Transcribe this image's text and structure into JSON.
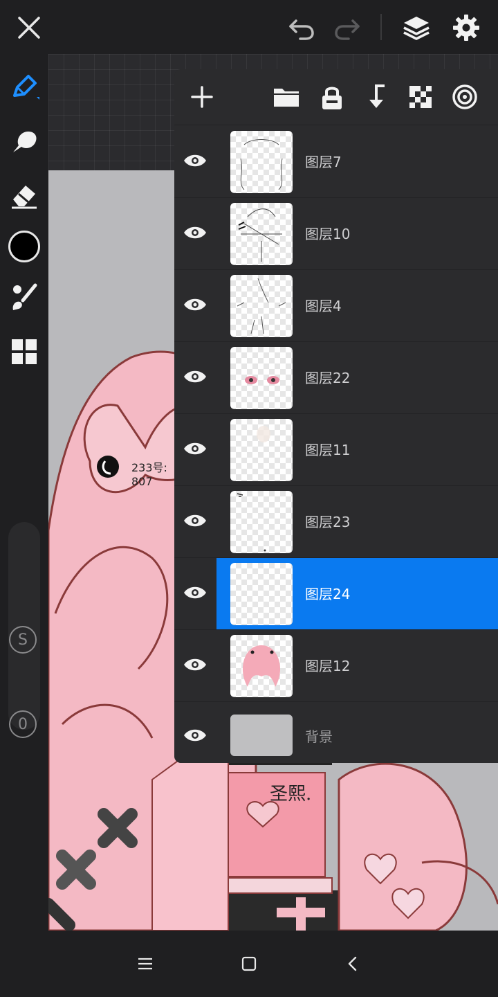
{
  "topbar": {
    "icons": [
      "close-icon",
      "undo-icon",
      "redo-icon",
      "layers-icon",
      "settings-icon"
    ]
  },
  "toolbar": {
    "tools": [
      "pen-icon",
      "smudge-icon",
      "eraser-icon",
      "color-swatch",
      "brush-icon",
      "gallery-icon"
    ],
    "current_color": "#000000",
    "size_badge": "S",
    "opacity_badge": "0"
  },
  "canvas": {
    "annotation_line1": "233号:",
    "annotation_line2": "807",
    "signature": "圣熙."
  },
  "layers_panel": {
    "actions": [
      "add-layer-icon",
      "folder-icon",
      "lock-icon",
      "merge-down-icon",
      "transparency-icon",
      "clipping-icon"
    ],
    "layers": [
      {
        "name": "图层7",
        "visible": true,
        "selected": false
      },
      {
        "name": "图层10",
        "visible": true,
        "selected": false
      },
      {
        "name": "图层4",
        "visible": true,
        "selected": false
      },
      {
        "name": "图层22",
        "visible": true,
        "selected": false
      },
      {
        "name": "图层11",
        "visible": true,
        "selected": false
      },
      {
        "name": "图层23",
        "visible": true,
        "selected": false
      },
      {
        "name": "图层24",
        "visible": true,
        "selected": true
      },
      {
        "name": "图层12",
        "visible": true,
        "selected": false
      },
      {
        "name": "背景",
        "visible": true,
        "selected": false
      }
    ]
  },
  "colors": {
    "selected_layer": "#0a7af0",
    "panel": "#2b2b2d",
    "chrome": "#1f1f21",
    "accent_pen": "#1e8fff"
  },
  "navbar": {
    "icons": [
      "menu-icon",
      "home-icon",
      "back-icon"
    ]
  }
}
